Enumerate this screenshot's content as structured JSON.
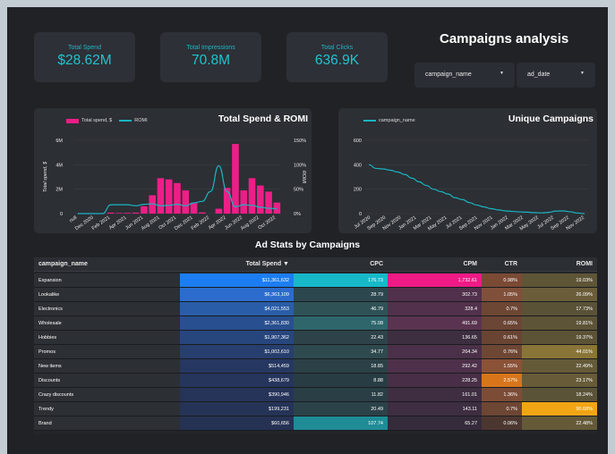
{
  "kpis": [
    {
      "label": "Total Spend",
      "value": "$28.62M"
    },
    {
      "label": "Total Impressions",
      "value": "70.8M"
    },
    {
      "label": "Total Clicks",
      "value": "636.9K"
    }
  ],
  "header": {
    "title": "Campaigns analysis"
  },
  "filters": [
    {
      "label": "campaign_name",
      "arrow": "▼"
    },
    {
      "label": "ad_date",
      "arrow": "▼"
    }
  ],
  "colors": {
    "spend_bar": "#ed1e87",
    "line": "#1ab4c2",
    "panel": "#2c2f34",
    "background": "#202226"
  },
  "chart_data": [
    {
      "type": "bar",
      "title": "Total Spend & ROMI",
      "legend": [
        "Total spend, $",
        "ROMI"
      ],
      "ylabel": "Total spend, $",
      "y2label": "ROMI",
      "yticks": [
        "6M",
        "4M",
        "2M",
        "0"
      ],
      "y2ticks": [
        "150%",
        "100%",
        "50%",
        "0%"
      ],
      "ylim": [
        0,
        6000000
      ],
      "y2lim": [
        0,
        150
      ],
      "xtick_labels": [
        "null",
        "Dec 2020",
        "Feb 2021",
        "Apr 2021",
        "Jun 2021",
        "Aug 2021",
        "Oct 2021",
        "Dec 2021",
        "Feb 2022",
        "Apr 2022",
        "Jun 2022",
        "Aug 2022",
        "Oct 2022"
      ],
      "series": [
        {
          "name": "Total spend, $",
          "type": "bar",
          "values": [
            0,
            0,
            0,
            20000,
            80000,
            50000,
            60000,
            80000,
            600000,
            1500000,
            2900000,
            2800000,
            2500000,
            1900000,
            900000,
            100000,
            0,
            400000,
            2100000,
            5700000,
            1900000,
            2900000,
            2300000,
            1800000,
            900000
          ]
        },
        {
          "name": "ROMI",
          "type": "line",
          "axis": "y2",
          "values": [
            0,
            0,
            0,
            0,
            18,
            18,
            18,
            16,
            19,
            20,
            16,
            17,
            19,
            16,
            22,
            25,
            45,
            98,
            45,
            14,
            18,
            17,
            13,
            11,
            10
          ]
        }
      ]
    },
    {
      "type": "line",
      "title": "Unique Campaigns",
      "legend": [
        "campaign_name"
      ],
      "yticks": [
        "600",
        "400",
        "200",
        "0"
      ],
      "ylim": [
        0,
        600
      ],
      "xtick_labels": [
        "Jul 2020",
        "Sep 2020",
        "Nov 2020",
        "Jan 2021",
        "Mar 2021",
        "May 2021",
        "Jul 2021",
        "Sep 2021",
        "Nov 2021",
        "Jan 2022",
        "Mar 2022",
        "May 2022",
        "Jul 2022",
        "Sep 2022",
        "Nov 2022"
      ],
      "series": [
        {
          "name": "campaign_name",
          "values": [
            400,
            370,
            365,
            355,
            340,
            320,
            290,
            260,
            230,
            200,
            180,
            160,
            130,
            115,
            90,
            70,
            55,
            40,
            30,
            22,
            18,
            14,
            12,
            8,
            6,
            10,
            20,
            22,
            15,
            5,
            0
          ]
        }
      ]
    }
  ],
  "table": {
    "title": "Ad Stats by Campaigns",
    "headers": [
      "campaign_name",
      "Total Spend ▼",
      "CPC",
      "CPM",
      "CTR",
      "ROMI"
    ],
    "rows": [
      [
        "Expansion",
        "$11,361,632",
        "176.73",
        "1,732.61",
        "0.98%",
        "19.03%"
      ],
      [
        "Lookalike",
        "$6,363,109",
        "28.79",
        "302.73",
        "1.05%",
        "26.09%"
      ],
      [
        "Electronics",
        "$4,021,553",
        "46.79",
        "328.4",
        "0.7%",
        "17.73%"
      ],
      [
        "Wholesale",
        "$2,361,830",
        "75.08",
        "491.69",
        "0.65%",
        "19.81%"
      ],
      [
        "Hobbies",
        "$1,907,362",
        "22.43",
        "136.65",
        "0.61%",
        "19.37%"
      ],
      [
        "Promos",
        "$1,002,610",
        "34.77",
        "264.34",
        "0.76%",
        "44.01%"
      ],
      [
        "New items",
        "$514,459",
        "18.85",
        "292.42",
        "1.55%",
        "22.49%"
      ],
      [
        "Discounts",
        "$438,679",
        "8.88",
        "228.25",
        "2.57%",
        "23.17%"
      ],
      [
        "Crazy discounts",
        "$390,946",
        "11.82",
        "161.01",
        "1.36%",
        "18.24%"
      ],
      [
        "Trendy",
        "$199,231",
        "20.49",
        "143.11",
        "0.7%",
        "90.68%"
      ],
      [
        "Brand",
        "$60,656",
        "107.74",
        "65.27",
        "0.06%",
        "22.48%"
      ]
    ],
    "cell_colors": [
      [
        "#2c2f34",
        "#1c7df2",
        "#17b9c9",
        "#ef1a86",
        "#7a4a35",
        "#5e5537"
      ],
      [
        "#2c2f34",
        "#2b6ccd",
        "#2d474f",
        "#51304b",
        "#81503a",
        "#6b5d39"
      ],
      [
        "#2c2f34",
        "#2a5da8",
        "#2f5257",
        "#52314c",
        "#6d4734",
        "#5a5237"
      ],
      [
        "#2c2f34",
        "#284f8f",
        "#2e666c",
        "#5a3350",
        "#6b4535",
        "#5d5437"
      ],
      [
        "#2c2f34",
        "#27467e",
        "#2d4349",
        "#3d2e40",
        "#694433",
        "#5c5337"
      ],
      [
        "#2c2f34",
        "#273f6e",
        "#2e4a4f",
        "#4a3048",
        "#6e4734",
        "#8a7538"
      ],
      [
        "#2c2f34",
        "#263861",
        "#2b4147",
        "#4e304a",
        "#8a5237",
        "#655a38"
      ],
      [
        "#2c2f34",
        "#26355c",
        "#283c43",
        "#482f47",
        "#d8751a",
        "#675b38"
      ],
      [
        "#2c2f34",
        "#26345a",
        "#293e45",
        "#3f2e42",
        "#7d4c37",
        "#5b5337"
      ],
      [
        "#2c2f34",
        "#253356",
        "#2b4249",
        "#3e2e41",
        "#6d4634",
        "#f2a514"
      ],
      [
        "#2c2f34",
        "#253254",
        "#1f8c96",
        "#342b3b",
        "#4c3730",
        "#655a38"
      ]
    ]
  }
}
